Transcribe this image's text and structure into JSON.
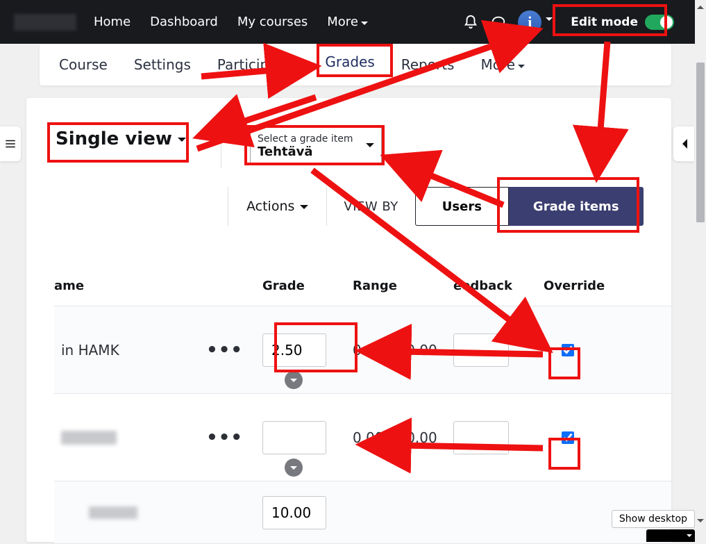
{
  "topnav": {
    "items": [
      "Home",
      "Dashboard",
      "My courses",
      "More"
    ]
  },
  "edit_mode": {
    "label": "Edit mode",
    "on": true
  },
  "avatar": {
    "letter": "i"
  },
  "secnav": {
    "items": [
      "Course",
      "Settings",
      "Participants",
      "Grades",
      "Reports",
      "More"
    ],
    "active": "Grades"
  },
  "singleview": {
    "label": "Single view"
  },
  "gradeitem": {
    "label": "Select a grade item",
    "value": "Tehtävä"
  },
  "actions": {
    "label": "Actions"
  },
  "viewby": {
    "label": "VIEW BY",
    "users": "Users",
    "grade_items": "Grade items"
  },
  "table": {
    "headers": {
      "name": "ame",
      "grade": "Grade",
      "range": "Range",
      "feedback": "eedback",
      "override": "Override"
    },
    "rows": [
      {
        "name": "in HAMK",
        "grade": "2.50",
        "range": "0.00 - 10.00",
        "override": true
      },
      {
        "name": " ",
        "grade": "",
        "range": "0.00 - 10.00",
        "override": true
      },
      {
        "name": " ",
        "grade": "10.00",
        "range": "",
        "override": true
      }
    ]
  },
  "show_desktop": "Show desktop"
}
